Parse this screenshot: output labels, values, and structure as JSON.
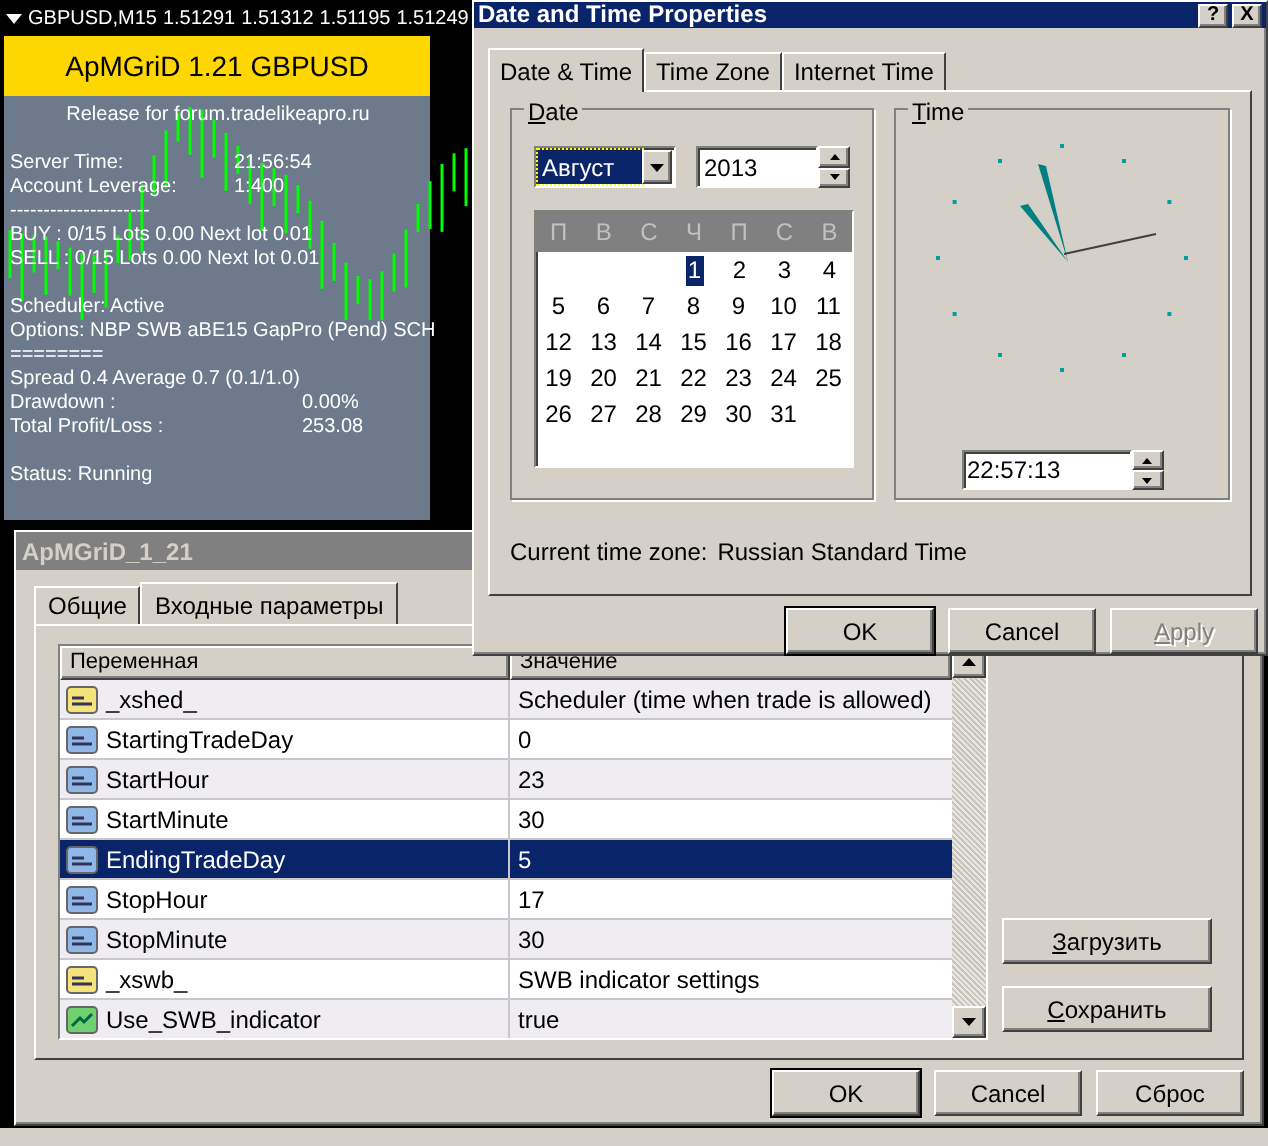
{
  "chart": {
    "symbol": "GBPUSD,M15",
    "prices": [
      "1.51291",
      "1.51312",
      "1.51195",
      "1.51249"
    ]
  },
  "info_panel": {
    "header": "ApMGriD 1.21 GBPUSD",
    "release": "Release for forum.tradelikeapro.ru",
    "lines": [
      {
        "kind": "spacer"
      },
      {
        "kind": "pair",
        "label": "Server Time:",
        "value": "21:56:54"
      },
      {
        "kind": "pair",
        "label": "Account Leverage:",
        "value": "1:400"
      },
      {
        "kind": "text",
        "text": "---------------------"
      },
      {
        "kind": "text",
        "text": "BUY : 0/15  Lots 0.00 Next lot 0.01"
      },
      {
        "kind": "text",
        "text": "SELL : 0/15  Lots 0.00 Next lot 0.01"
      },
      {
        "kind": "spacer"
      },
      {
        "kind": "text",
        "text": "Scheduler: Active"
      },
      {
        "kind": "text",
        "text": "Options: NBP SWB aBE15 GapPro (Pend) SCH"
      },
      {
        "kind": "text",
        "text": "========"
      },
      {
        "kind": "text",
        "text": "Spread 0.4 Average 0.7 (0.1/1.0)"
      },
      {
        "kind": "pair_far",
        "label": "Drawdown :",
        "value": "0.00%"
      },
      {
        "kind": "pair_far",
        "label": "Total Profit/Loss :",
        "value": "253.08"
      },
      {
        "kind": "spacer"
      },
      {
        "kind": "text",
        "text": "Status: Running"
      }
    ]
  },
  "date_dialog": {
    "title": "Date and Time Properties",
    "title_buttons": [
      "?",
      "X"
    ],
    "tabs": [
      {
        "label": "Date & Time",
        "selected": true
      },
      {
        "label": "Time Zone",
        "selected": false
      },
      {
        "label": "Internet Time",
        "selected": false
      }
    ],
    "date_group": {
      "label": "Date",
      "month": "Август",
      "year": "2013",
      "weekdays": [
        "П",
        "В",
        "С",
        "Ч",
        "П",
        "С",
        "В"
      ],
      "weeks": [
        {
          "kind": "first_week",
          "days": [
            {
              "day": "1",
              "selected": true
            },
            {
              "day": "2",
              "selected": false
            },
            {
              "day": "3",
              "selected": false
            },
            {
              "day": "4",
              "selected": false
            }
          ]
        },
        {
          "kind": "week",
          "days": [
            {
              "day": "5",
              "selected": false
            },
            {
              "day": "6",
              "selected": false
            },
            {
              "day": "7",
              "selected": false
            },
            {
              "day": "8",
              "selected": false
            },
            {
              "day": "9",
              "selected": false
            },
            {
              "day": "10",
              "selected": false
            },
            {
              "day": "11",
              "selected": false
            }
          ]
        },
        {
          "kind": "week",
          "days": [
            {
              "day": "12",
              "selected": false
            },
            {
              "day": "13",
              "selected": false
            },
            {
              "day": "14",
              "selected": false
            },
            {
              "day": "15",
              "selected": false
            },
            {
              "day": "16",
              "selected": false
            },
            {
              "day": "17",
              "selected": false
            },
            {
              "day": "18",
              "selected": false
            }
          ]
        },
        {
          "kind": "week",
          "days": [
            {
              "day": "19",
              "selected": false
            },
            {
              "day": "20",
              "selected": false
            },
            {
              "day": "21",
              "selected": false
            },
            {
              "day": "22",
              "selected": false
            },
            {
              "day": "23",
              "selected": false
            },
            {
              "day": "24",
              "selected": false
            },
            {
              "day": "25",
              "selected": false
            }
          ]
        },
        {
          "kind": "week",
          "days": [
            {
              "day": "26",
              "selected": false
            },
            {
              "day": "27",
              "selected": false
            },
            {
              "day": "28",
              "selected": false
            },
            {
              "day": "29",
              "selected": false
            },
            {
              "day": "30",
              "selected": false
            },
            {
              "day": "31",
              "selected": false
            }
          ]
        }
      ]
    },
    "time_group": {
      "label": "Time",
      "time": "22:57:13"
    },
    "timezone": {
      "label": "Current time zone:",
      "value": "Russian Standard Time"
    },
    "buttons": [
      {
        "label": "OK",
        "disabled": false,
        "default": true
      },
      {
        "label": "Cancel",
        "disabled": false,
        "default": false
      },
      {
        "label": "Apply",
        "disabled": true,
        "default": false
      }
    ]
  },
  "params_window": {
    "title": "ApMGriD_1_21",
    "tabs": [
      {
        "label": "Общие",
        "selected": false
      },
      {
        "label": "Входные параметры",
        "selected": true
      }
    ],
    "columns": [
      "Переменная",
      "Значение"
    ],
    "rows": [
      {
        "kind": "string",
        "name": "_xshed_",
        "value": "Scheduler (time when trade is allowed)",
        "selected": false
      },
      {
        "kind": "int",
        "name": "StartingTradeDay",
        "value": "0",
        "selected": false
      },
      {
        "kind": "int",
        "name": "StartHour",
        "value": "23",
        "selected": false
      },
      {
        "kind": "int",
        "name": "StartMinute",
        "value": "30",
        "selected": false
      },
      {
        "kind": "int",
        "name": "EndingTradeDay",
        "value": "5",
        "selected": true
      },
      {
        "kind": "int",
        "name": "StopHour",
        "value": "17",
        "selected": false
      },
      {
        "kind": "int",
        "name": "StopMinute",
        "value": "30",
        "selected": false
      },
      {
        "kind": "string",
        "name": "_xswb_",
        "value": "SWB indicator settings",
        "selected": false
      },
      {
        "kind": "bool",
        "name": "Use_SWB_indicator",
        "value": "true",
        "selected": false
      }
    ],
    "side_buttons": [
      "Загрузить",
      "Сохранить"
    ],
    "buttons": [
      {
        "label": "OK",
        "default": true
      },
      {
        "label": "Cancel",
        "default": false
      },
      {
        "label": "Сброс",
        "default": false
      }
    ]
  }
}
